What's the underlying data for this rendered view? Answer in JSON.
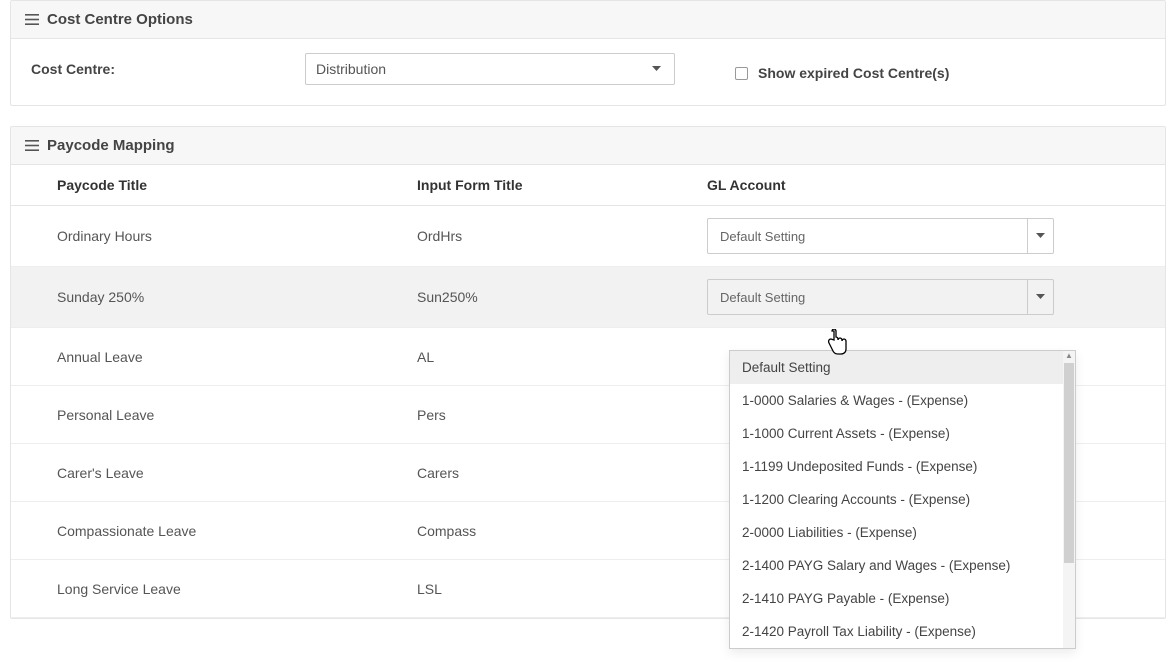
{
  "panels": {
    "cost_centre": {
      "title": "Cost Centre Options",
      "label": "Cost Centre:",
      "select_value": "Distribution",
      "show_expired_label": "Show expired Cost Centre(s)"
    },
    "paycode": {
      "title": "Paycode Mapping",
      "columns": {
        "title": "Paycode Title",
        "form": "Input Form Title",
        "gl": "GL Account"
      },
      "default_setting_label": "Default Setting",
      "rows": [
        {
          "title": "Ordinary Hours",
          "form": "OrdHrs",
          "has_select": true,
          "active": false
        },
        {
          "title": "Sunday 250%",
          "form": "Sun250%",
          "has_select": true,
          "active": true
        },
        {
          "title": "Annual Leave",
          "form": "AL",
          "has_select": false,
          "active": false
        },
        {
          "title": "Personal Leave",
          "form": "Pers",
          "has_select": false,
          "active": false
        },
        {
          "title": "Carer's Leave",
          "form": "Carers",
          "has_select": false,
          "active": false
        },
        {
          "title": "Compassionate Leave",
          "form": "Compass",
          "has_select": false,
          "active": false
        },
        {
          "title": "Long Service Leave",
          "form": "LSL",
          "has_select": false,
          "active": false
        }
      ]
    }
  },
  "dropdown": {
    "options": [
      "Default Setting",
      "1-0000 Salaries & Wages - (Expense)",
      "1-1000 Current Assets - (Expense)",
      "1-1199 Undeposited Funds - (Expense)",
      "1-1200 Clearing Accounts - (Expense)",
      "2-0000 Liabilities - (Expense)",
      "2-1400 PAYG Salary and Wages - (Expense)",
      "2-1410 PAYG Payable - (Expense)",
      "2-1420 Payroll Tax Liability - (Expense)"
    ]
  }
}
